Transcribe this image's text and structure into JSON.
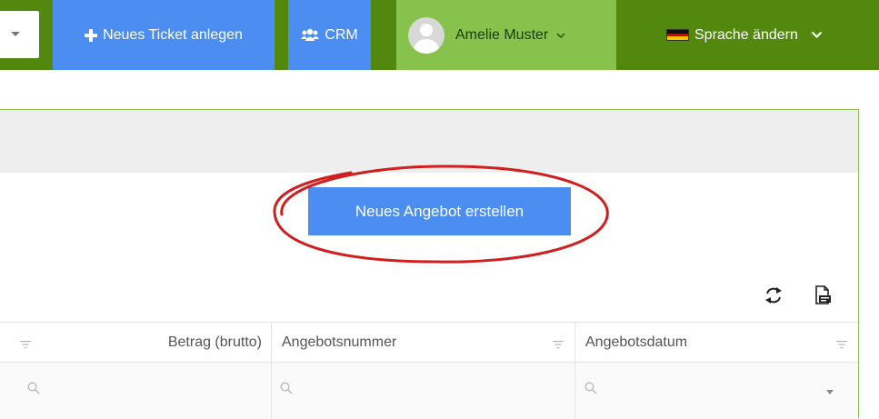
{
  "topbar": {
    "new_ticket_label": "Neues Ticket anlegen",
    "crm_label": "CRM",
    "user_name": "Amelie Muster",
    "language_label": "Sprache ändern"
  },
  "panel": {
    "create_offer_label": "Neues Angebot erstellen"
  },
  "grid": {
    "columns": [
      {
        "label": "Betrag (brutto)"
      },
      {
        "label": "Angebotsnummer"
      },
      {
        "label": "Angebotsdatum"
      }
    ]
  },
  "colors": {
    "header_green": "#53880f",
    "user_green": "#86c24c",
    "accent_blue": "#4b8df0",
    "highlight_red": "#d11f1f"
  },
  "icons": [
    "plus-icon",
    "users-icon",
    "avatar",
    "chevron-down-icon",
    "flag-de-icon",
    "refresh-icon",
    "export-pdf-icon",
    "filter-icon",
    "search-icon"
  ]
}
